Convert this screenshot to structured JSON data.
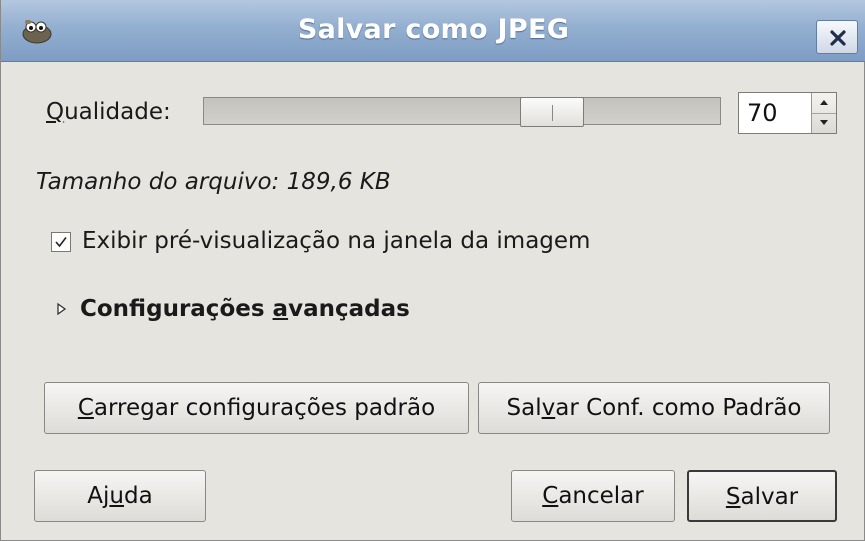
{
  "window": {
    "title": "Salvar como JPEG",
    "app_icon": "gimp-wilber-icon",
    "close_icon": "close-icon"
  },
  "quality": {
    "label_mnemonic": "Q",
    "label_rest": "ualidade:",
    "value": "70",
    "slider_fraction": 0.7,
    "spin_up_icon": "arrow-up-icon",
    "spin_down_icon": "arrow-down-icon"
  },
  "file_size": {
    "text": "Tamanho do arquivo: 189,6 KB"
  },
  "preview": {
    "label": "Exibir pré-visualização na janela da imagem",
    "checked": true
  },
  "advanced": {
    "label_before": "Configurações ",
    "label_mnemonic": "a",
    "label_after": "vançadas",
    "expander_icon": "triangle-right-icon"
  },
  "buttons": {
    "load_defaults": {
      "mnemonic": "C",
      "rest": "arregar configurações padrão"
    },
    "save_defaults": {
      "before": "Sal",
      "mnemonic": "v",
      "after": "ar Conf. como Padrão"
    },
    "help": {
      "before": "Aj",
      "mnemonic": "u",
      "after": "da"
    },
    "cancel": {
      "mnemonic": "C",
      "rest": "ancelar"
    },
    "save": {
      "mnemonic": "S",
      "rest": "alvar"
    }
  }
}
